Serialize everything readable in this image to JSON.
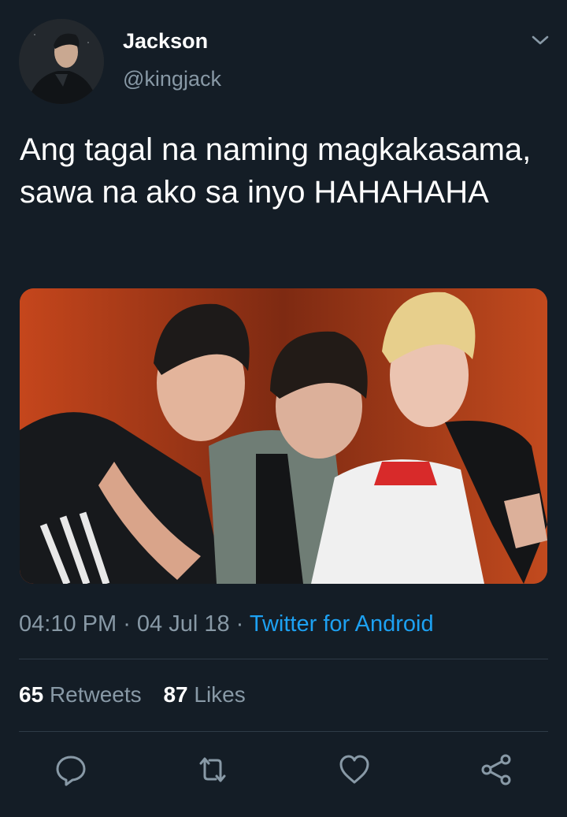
{
  "user": {
    "name": "Jackson",
    "handle": "@kingjack"
  },
  "tweet": {
    "text": "Ang tagal na naming magkakasama, sawa na ako sa inyo HAHAHAHA",
    "media_alt": "photo"
  },
  "meta": {
    "time": "04:10 PM",
    "separator": " · ",
    "date": "04 Jul 18",
    "source": "Twitter for Android"
  },
  "stats": {
    "retweets_count": "65",
    "retweets_label": "Retweets",
    "likes_count": "87",
    "likes_label": "Likes"
  },
  "icons": {
    "menu": "chevron-down-icon",
    "reply": "reply-icon",
    "retweet": "retweet-icon",
    "like": "heart-icon",
    "share": "share-icon"
  },
  "colors": {
    "background": "#141d26",
    "secondary_text": "#8899a6",
    "link": "#1da1f2",
    "divider": "#2f3b47"
  }
}
